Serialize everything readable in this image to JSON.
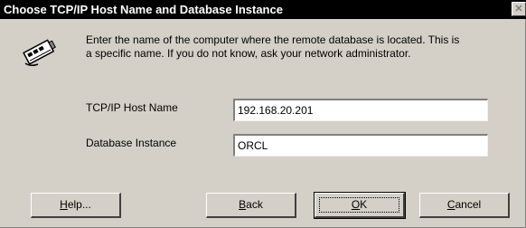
{
  "window": {
    "title": "Choose TCP/IP Host Name and Database Instance",
    "close_glyph": "✕"
  },
  "message": {
    "line1": "Enter the name of the computer where the remote database is located.  This is",
    "line2": "a specific name.  If you do not know, ask your network administrator."
  },
  "fields": {
    "host_label": "TCP/IP Host Name",
    "host_value": "192.168.20.201",
    "instance_label": "Database Instance",
    "instance_value": "ORCL"
  },
  "buttons": {
    "help": {
      "mnemonic": "H",
      "rest": "elp..."
    },
    "back": {
      "mnemonic": "B",
      "rest": "ack"
    },
    "ok": {
      "mnemonic": "O",
      "rest": "K"
    },
    "cancel": {
      "mnemonic": "C",
      "rest": "ancel"
    }
  }
}
